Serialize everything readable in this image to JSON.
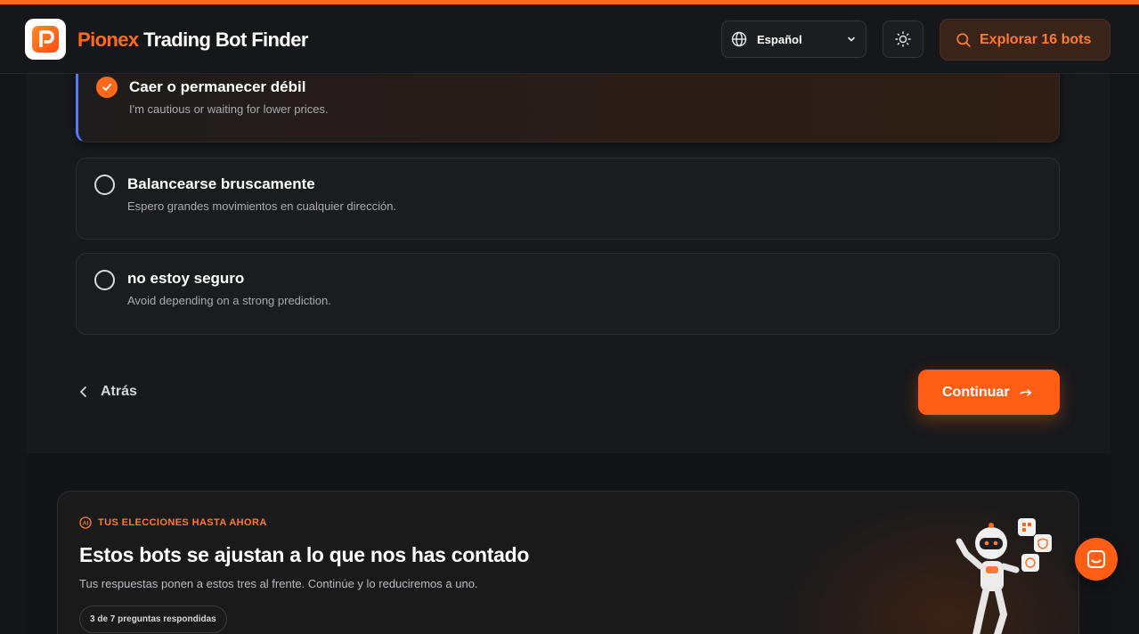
{
  "header": {
    "brand_primary": "Pionex",
    "brand_secondary": "Trading Bot Finder",
    "language": "Español",
    "explore_label": "Explorar 16 bots"
  },
  "options": [
    {
      "title": "Caer o permanecer débil",
      "desc": "I'm cautious or waiting for lower prices.",
      "selected": true
    },
    {
      "title": "Balancearse bruscamente",
      "desc": "Espero grandes movimientos en cualquier dirección.",
      "selected": false
    },
    {
      "title": "no estoy seguro",
      "desc": "Avoid depending on a strong prediction.",
      "selected": false
    }
  ],
  "nav": {
    "back_label": "Atrás",
    "continue_label": "Continuar"
  },
  "summary": {
    "eyebrow": "TUS ELECCIONES HASTA AHORA",
    "title": "Estos bots se ajustan a lo que nos has contado",
    "subtitle": "Tus respuestas ponen a estos tres al frente. Continúe y lo reduciremos a uno.",
    "progress": "3 de 7 preguntas respondidas"
  },
  "colors": {
    "accent": "#ff6a1a",
    "selected_border": "#4a7dff",
    "background": "#18191c"
  }
}
